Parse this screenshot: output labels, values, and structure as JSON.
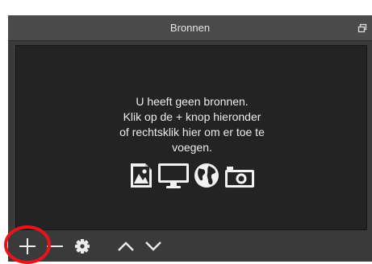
{
  "dock": {
    "title": "Bronnen"
  },
  "empty_state": {
    "lines": [
      "U heeft geen bronnen.",
      "Klik op de + knop hieronder",
      "of rechtsklik hier om er toe te",
      "voegen."
    ]
  },
  "source_type_icons": [
    "image-icon",
    "monitor-icon",
    "globe-icon",
    "camera-icon"
  ],
  "toolbar": {
    "buttons": [
      "plus-icon",
      "minus-icon",
      "gear-icon",
      "chevron-up-icon",
      "chevron-down-icon"
    ]
  },
  "colors": {
    "panel": "#3a3a3a",
    "list_background": "#232323",
    "text": "#ececec",
    "highlight": "#e8141c"
  }
}
